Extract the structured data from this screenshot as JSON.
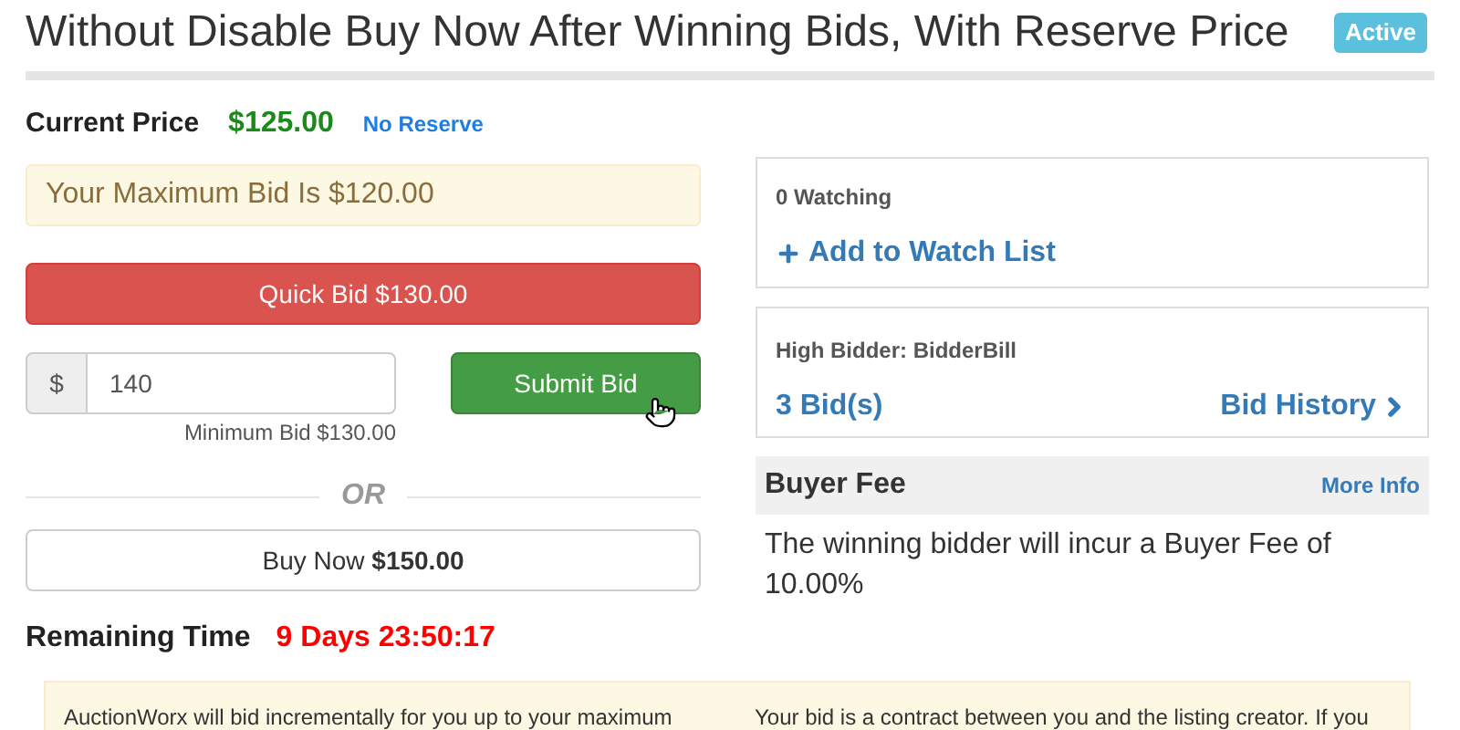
{
  "title": "Without Disable Buy Now After Winning Bids, With Reserve Price",
  "status_badge": "Active",
  "current_price": {
    "label": "Current Price",
    "value": "$125.00",
    "reserve": "No Reserve"
  },
  "max_bid_notice": "Your Maximum Bid Is $120.00",
  "quick_bid_button": "Quick Bid $130.00",
  "bid_field": {
    "prefix": "$",
    "value": "140",
    "hint": "Minimum Bid $130.00"
  },
  "submit_button": "Submit Bid",
  "divider_text": "OR",
  "buy_now_button": "Buy Now **$150.00**",
  "remaining_time": {
    "label": "Remaining Time",
    "value": "9 Days 23:50:17"
  },
  "watch_panel": {
    "count": "0 Watching",
    "link": "Add to Watch List"
  },
  "bid_panel": {
    "high_bidder": "High Bidder: BidderBill",
    "bids": "3 Bid(s)",
    "history": "Bid History"
  },
  "buyer_fee": {
    "title": "Buyer Fee",
    "link": "More Info",
    "text": "The winning bidder will incur a Buyer Fee of 10.00%"
  },
  "notice": [
    "AuctionWorx will bid incrementally for you up to your maximum",
    "Your bid is a contract between you and the listing creator. If you"
  ]
}
